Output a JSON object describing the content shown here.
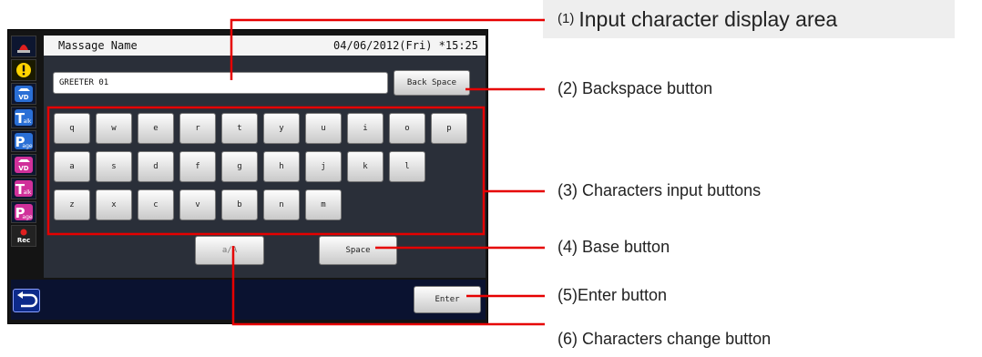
{
  "screen": {
    "title": "Massage Name",
    "datetime": "04/06/2012(Fri) *15:25",
    "input_value": "GREETER 01",
    "backspace_label": "Back Space",
    "space_label": "Space",
    "change_label": "a/A",
    "enter_label": "Enter",
    "keys_row1": [
      "q",
      "w",
      "e",
      "r",
      "t",
      "y",
      "u",
      "i",
      "o",
      "p"
    ],
    "keys_row2": [
      "a",
      "s",
      "d",
      "f",
      "g",
      "h",
      "j",
      "k",
      "l"
    ],
    "keys_row3": [
      "z",
      "x",
      "c",
      "v",
      "b",
      "n",
      "m"
    ],
    "sidebar": [
      {
        "icon": "alarm-lamp-icon",
        "text": ""
      },
      {
        "icon": "warning-icon",
        "text": "!"
      },
      {
        "icon": "vehicle-vd-icon",
        "text": "VD"
      },
      {
        "icon": "talk-icon",
        "text": "T"
      },
      {
        "icon": "page-icon",
        "text": "P"
      },
      {
        "icon": "vehicle-vd-icon",
        "text": "VD"
      },
      {
        "icon": "talk-icon",
        "text": "T"
      },
      {
        "icon": "page-icon",
        "text": "P"
      },
      {
        "icon": "record-icon",
        "text": "Rec"
      }
    ]
  },
  "callouts": {
    "c1_num": "(1)",
    "c1": "Input character display area",
    "c2": "(2) Backspace button",
    "c3": "(3) Characters input buttons",
    "c4": "(4) Base button",
    "c5": "(5)Enter button",
    "c6": "(6) Characters change button"
  },
  "colors": {
    "callout_line": "#e60000",
    "highlight_frame": "#e60000",
    "blue_icon": "#2a6fd6",
    "magenta_icon": "#d0309a"
  }
}
